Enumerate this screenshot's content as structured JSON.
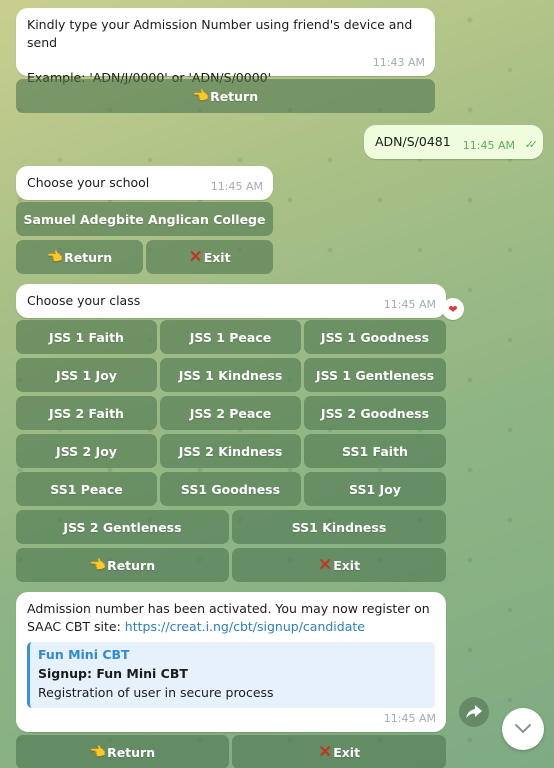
{
  "messages": {
    "m1": {
      "line1": "Kindly type your Admission Number using friend's device and send",
      "line2": "Example: 'ADN/J/0000' or 'ADN/S/0000'",
      "time": "11:43 AM",
      "buttons": {
        "return": "Return"
      }
    },
    "m2": {
      "text": "ADN/S/0481",
      "time": "11:45 AM"
    },
    "m3": {
      "text": "Choose your school",
      "time": "11:45 AM",
      "buttons": {
        "school": "Samuel Adegbite Anglican College",
        "return": "Return",
        "exit": "Exit"
      }
    },
    "m4": {
      "text": "Choose your class",
      "time": "11:45 AM",
      "reaction": "❤",
      "classes": [
        "JSS 1 Faith",
        "JSS 1 Peace",
        "JSS 1 Goodness",
        "JSS 1 Joy",
        "JSS 1 Kindness",
        "JSS 1 Gentleness",
        "JSS 2 Faith",
        "JSS 2 Peace",
        "JSS 2 Goodness",
        "JSS 2 Joy",
        "JSS 2 Kindness",
        "SS1 Faith",
        "SS1 Peace",
        "SS1 Goodness",
        "SS1 Joy",
        "JSS 2 Gentleness",
        "SS1 Kindness"
      ],
      "buttons": {
        "return": "Return",
        "exit": "Exit"
      }
    },
    "m5": {
      "text": "Admission number has been activated. You may now register on SAAC CBT site:",
      "link": "https://creat.i.ng/cbt/signup/candidate",
      "preview": {
        "title": "Fun Mini CBT",
        "subtitle": "Signup: Fun Mini CBT",
        "description": "Registration of user in secure process"
      },
      "time": "11:45 AM",
      "buttons": {
        "return": "Return",
        "exit": "Exit"
      }
    }
  },
  "icons": {
    "return": "backhand-index-pointing-left",
    "exit": "cross-mark",
    "read": "double-check",
    "forward": "share-arrow",
    "scroll": "chevron-down"
  }
}
